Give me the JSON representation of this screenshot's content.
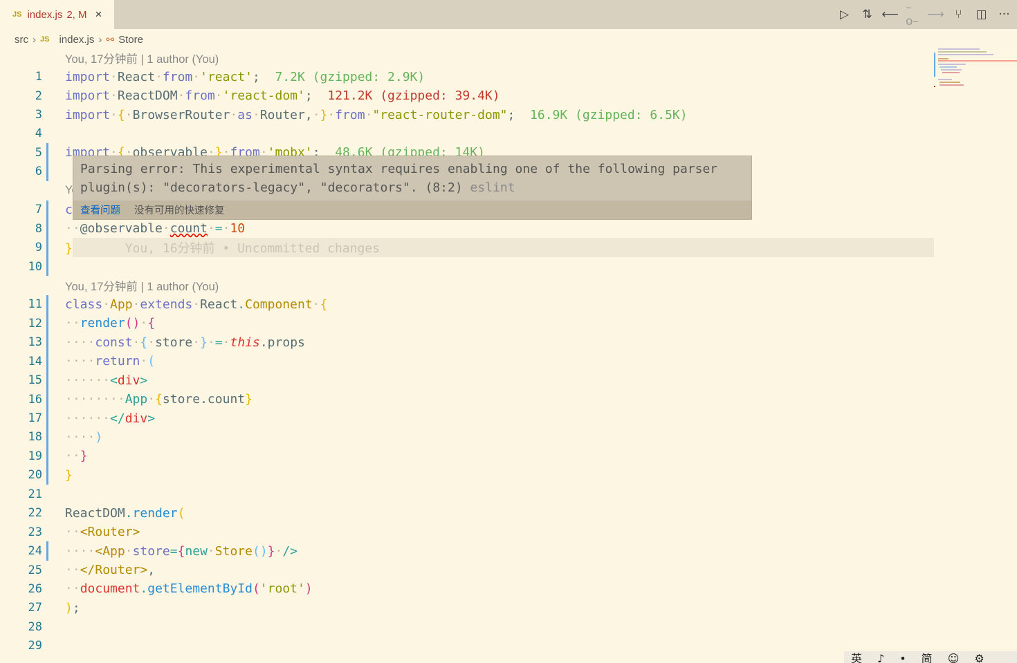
{
  "tab": {
    "icon": "JS",
    "name": "index.js",
    "badge": "2, M",
    "close": "×"
  },
  "actions": [
    {
      "name": "run-icon",
      "glyph": "▷"
    },
    {
      "name": "compare-changes-icon",
      "glyph": "⇅"
    },
    {
      "name": "previous-change-icon",
      "glyph": "⟵"
    },
    {
      "name": "current-change-icon",
      "glyph": "–o–"
    },
    {
      "name": "next-change-icon",
      "glyph": "⟶"
    },
    {
      "name": "git-graph-icon",
      "glyph": "⑂"
    },
    {
      "name": "split-editor-icon",
      "glyph": "◫"
    },
    {
      "name": "more-actions-icon",
      "glyph": "···"
    }
  ],
  "breadcrumb": {
    "folder": "src",
    "file": "index.js",
    "symbol": "Store"
  },
  "rows": [
    {
      "blame": "You, 17分钟前 | 1 author (You)"
    },
    {
      "ln": "1",
      "git": false,
      "t": [
        [
          "kw",
          "import"
        ],
        [
          "ws",
          "·"
        ],
        [
          "id",
          "React"
        ],
        [
          "ws",
          "·"
        ],
        [
          "kw",
          "from"
        ],
        [
          "ws",
          "·"
        ],
        [
          "str",
          "'react'"
        ],
        [
          "id",
          ";  "
        ],
        [
          "sz",
          "7.2K (gzipped: 2.9K)"
        ]
      ]
    },
    {
      "ln": "2",
      "t": [
        [
          "kw",
          "import"
        ],
        [
          "ws",
          "·"
        ],
        [
          "id",
          "ReactDOM"
        ],
        [
          "ws",
          "·"
        ],
        [
          "kw",
          "from"
        ],
        [
          "ws",
          "·"
        ],
        [
          "str",
          "'react-dom'"
        ],
        [
          "id",
          ";  "
        ],
        [
          "szr",
          "121.2K (gzipped: 39.4K)"
        ]
      ]
    },
    {
      "ln": "3",
      "t": [
        [
          "kw",
          "import"
        ],
        [
          "ws",
          "·"
        ],
        [
          "br1",
          "{"
        ],
        [
          "ws",
          "·"
        ],
        [
          "id",
          "BrowserRouter"
        ],
        [
          "ws",
          "·"
        ],
        [
          "kw",
          "as"
        ],
        [
          "ws",
          "·"
        ],
        [
          "id",
          "Router,"
        ],
        [
          "ws",
          "·"
        ],
        [
          "br1",
          "}"
        ],
        [
          "ws",
          "·"
        ],
        [
          "kw",
          "from"
        ],
        [
          "ws",
          "·"
        ],
        [
          "str",
          "\"react-router-dom\""
        ],
        [
          "id",
          ";  "
        ],
        [
          "sz",
          "16.9K (gzipped: 6.5K)"
        ]
      ]
    },
    {
      "ln": "4",
      "t": []
    },
    {
      "ln": "5",
      "git": true,
      "t": [
        [
          "kw",
          "import"
        ],
        [
          "ws",
          "·"
        ],
        [
          "br1",
          "{"
        ],
        [
          "ws",
          "·"
        ],
        [
          "id",
          "observable"
        ],
        [
          "ws",
          "·"
        ],
        [
          "br1",
          "}"
        ],
        [
          "ws",
          "·"
        ],
        [
          "kw",
          "from"
        ],
        [
          "ws",
          "·"
        ],
        [
          "str",
          "'mobx'"
        ],
        [
          "id",
          ";  "
        ],
        [
          "sz",
          "48.6K (gzipped: 14K)"
        ]
      ]
    },
    {
      "ln": "6",
      "git": true,
      "t": []
    },
    {
      "blame": "Yo"
    },
    {
      "ln": "7",
      "git": true,
      "t": [
        [
          "kw",
          "c"
        ]
      ]
    },
    {
      "ln": "8",
      "git": true,
      "t": [
        [
          "ws",
          "··"
        ],
        [
          "id",
          "@observable"
        ],
        [
          "ws",
          "·"
        ],
        [
          "id err",
          "count"
        ],
        [
          "ws",
          "·"
        ],
        [
          "op",
          "="
        ],
        [
          "ws",
          "·"
        ],
        [
          "num",
          "10"
        ]
      ]
    },
    {
      "ln": "9",
      "git": true,
      "cur": true,
      "t": [
        [
          "br1",
          "}"
        ],
        [
          "ghost",
          "       You, 16分钟前 • Uncommitted changes"
        ]
      ]
    },
    {
      "ln": "10",
      "git": true,
      "t": []
    },
    {
      "blame": "You, 17分钟前 | 1 author (You)"
    },
    {
      "ln": "11",
      "git": true,
      "t": [
        [
          "kw",
          "class"
        ],
        [
          "ws",
          "·"
        ],
        [
          "cls",
          "App"
        ],
        [
          "ws",
          "·"
        ],
        [
          "kw",
          "extends"
        ],
        [
          "ws",
          "·"
        ],
        [
          "id",
          "React"
        ],
        [
          "op",
          "."
        ],
        [
          "cls",
          "Component"
        ],
        [
          "ws",
          "·"
        ],
        [
          "br1",
          "{"
        ]
      ]
    },
    {
      "ln": "12",
      "git": true,
      "t": [
        [
          "ws",
          "··"
        ],
        [
          "fn",
          "render"
        ],
        [
          "br2",
          "()"
        ],
        [
          "ws",
          "·"
        ],
        [
          "br2",
          "{"
        ]
      ]
    },
    {
      "ln": "13",
      "git": true,
      "t": [
        [
          "ws",
          "····"
        ],
        [
          "kw",
          "const"
        ],
        [
          "ws",
          "·"
        ],
        [
          "br3",
          "{"
        ],
        [
          "ws",
          "·"
        ],
        [
          "id",
          "store"
        ],
        [
          "ws",
          "·"
        ],
        [
          "br3",
          "}"
        ],
        [
          "ws",
          "·"
        ],
        [
          "op",
          "="
        ],
        [
          "ws",
          "·"
        ],
        [
          "this",
          "this"
        ],
        [
          "id",
          ".props"
        ]
      ]
    },
    {
      "ln": "14",
      "git": true,
      "t": [
        [
          "ws",
          "····"
        ],
        [
          "kw",
          "return"
        ],
        [
          "ws",
          "·"
        ],
        [
          "br3",
          "("
        ]
      ]
    },
    {
      "ln": "15",
      "git": true,
      "t": [
        [
          "ws",
          "······"
        ],
        [
          "tagb",
          "<"
        ],
        [
          "tag",
          "div"
        ],
        [
          "tagb",
          ">"
        ]
      ]
    },
    {
      "ln": "16",
      "git": true,
      "t": [
        [
          "ws",
          "········"
        ],
        [
          "jsx",
          "App"
        ],
        [
          "ws",
          "·"
        ],
        [
          "br1",
          "{"
        ],
        [
          "id",
          "store.count"
        ],
        [
          "br1",
          "}"
        ]
      ]
    },
    {
      "ln": "17",
      "git": true,
      "t": [
        [
          "ws",
          "······"
        ],
        [
          "tagb",
          "</"
        ],
        [
          "tag",
          "div"
        ],
        [
          "tagb",
          ">"
        ]
      ]
    },
    {
      "ln": "18",
      "git": true,
      "t": [
        [
          "ws",
          "····"
        ],
        [
          "br3",
          ")"
        ]
      ]
    },
    {
      "ln": "19",
      "git": true,
      "t": [
        [
          "ws",
          "··"
        ],
        [
          "br2",
          "}"
        ]
      ]
    },
    {
      "ln": "20",
      "git": true,
      "t": [
        [
          "br1",
          "}"
        ]
      ]
    },
    {
      "ln": "21",
      "t": []
    },
    {
      "ln": "22",
      "t": [
        [
          "id",
          "ReactDOM"
        ],
        [
          "op",
          "."
        ],
        [
          "fn",
          "render"
        ],
        [
          "br1",
          "("
        ]
      ]
    },
    {
      "ln": "23",
      "t": [
        [
          "ws",
          "··"
        ],
        [
          "cls",
          "<Router>"
        ]
      ]
    },
    {
      "ln": "24",
      "git": true,
      "t": [
        [
          "ws",
          "····"
        ],
        [
          "cls",
          "<App"
        ],
        [
          "ws",
          "·"
        ],
        [
          "attr",
          "store"
        ],
        [
          "op",
          "="
        ],
        [
          "br2",
          "{"
        ],
        [
          "jsx",
          "new"
        ],
        [
          "ws",
          "·"
        ],
        [
          "cls",
          "Store"
        ],
        [
          "br3",
          "()"
        ],
        [
          "br2",
          "}"
        ],
        [
          "ws",
          "·"
        ],
        [
          "op",
          "/>"
        ]
      ]
    },
    {
      "ln": "25",
      "t": [
        [
          "ws",
          "··"
        ],
        [
          "cls",
          "</Router>"
        ],
        [
          "id",
          ","
        ]
      ]
    },
    {
      "ln": "26",
      "t": [
        [
          "ws",
          "··"
        ],
        [
          "doc",
          "document"
        ],
        [
          "op",
          "."
        ],
        [
          "fn",
          "getElementById"
        ],
        [
          "br2",
          "("
        ],
        [
          "str",
          "'root'"
        ],
        [
          "br2",
          ")"
        ]
      ]
    },
    {
      "ln": "27",
      "t": [
        [
          "br1",
          ")"
        ],
        [
          "id",
          ";"
        ]
      ]
    },
    {
      "ln": "28",
      "t": []
    },
    {
      "ln": "29",
      "t": []
    }
  ],
  "hover": {
    "message": "Parsing error: This experimental syntax requires enabling one of the following parser plugin(s): \"decorators-legacy\", \"decorators\". (8:2)",
    "source": "eslint",
    "view_problem": "查看问题",
    "no_fix": "没有可用的快速修复"
  },
  "ime": [
    "英",
    "♪",
    "•",
    "简",
    "☺",
    "⚙"
  ]
}
